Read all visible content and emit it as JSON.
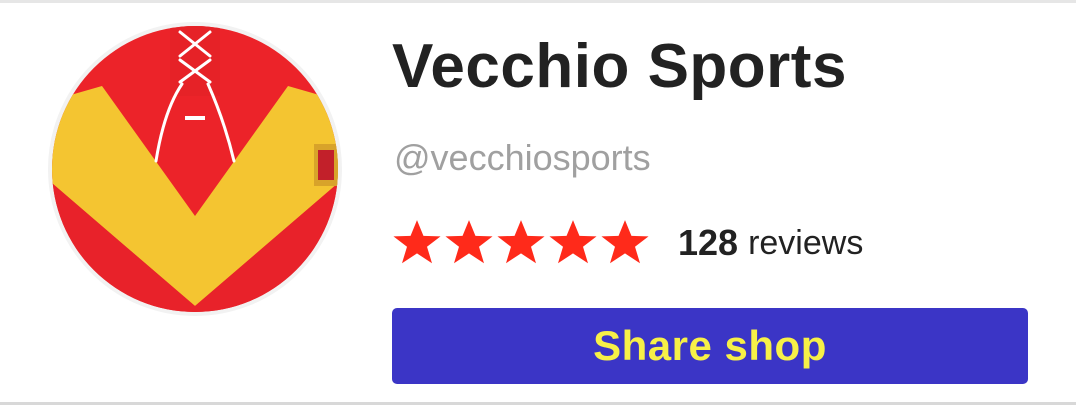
{
  "shop": {
    "name": "Vecchio Sports",
    "handle": "@vecchiosports"
  },
  "rating": {
    "stars": 5,
    "max_stars": 5,
    "review_count": "128",
    "review_label": "reviews"
  },
  "actions": {
    "share_label": "Share shop"
  },
  "colors": {
    "star": "#ff2a1a",
    "button_bg": "#3b35c6",
    "button_text": "#f7f047",
    "jersey_red": "#ec2329",
    "jersey_yellow": "#f4c531"
  }
}
